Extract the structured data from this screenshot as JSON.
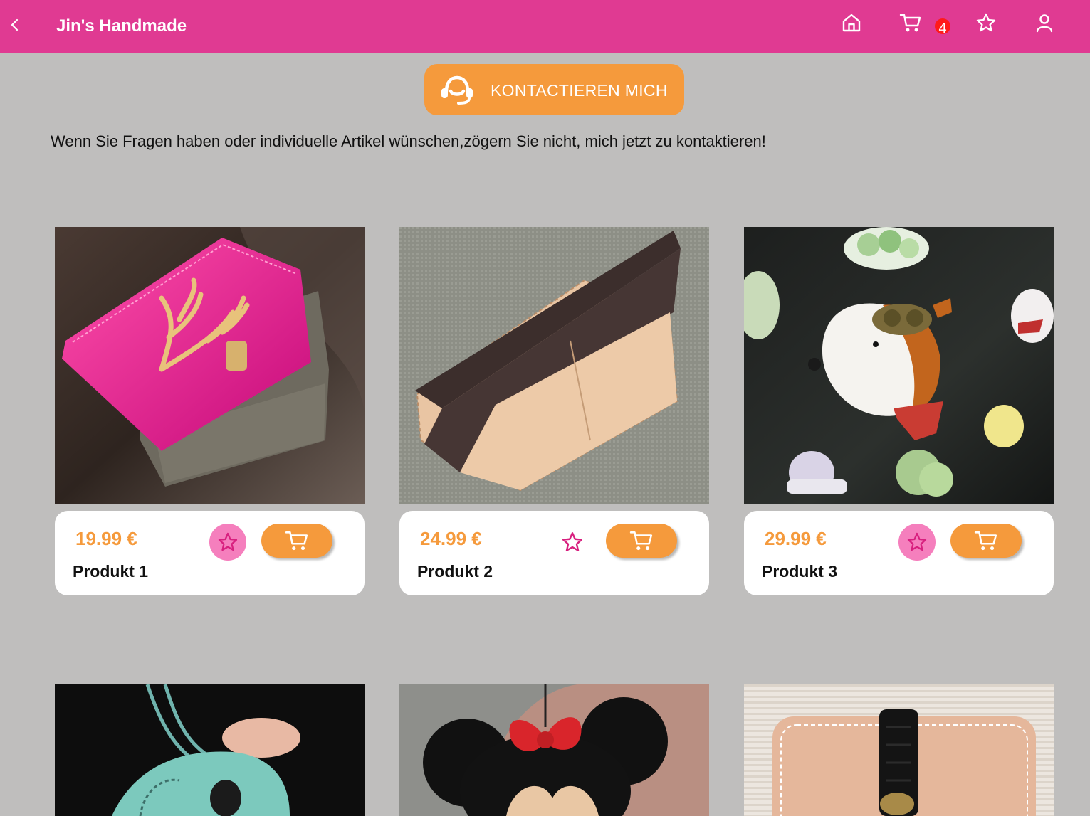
{
  "header": {
    "title": "Jin's Handmade",
    "back_icon": "chevron-left-icon",
    "nav_icons": [
      "home-icon",
      "cart-icon",
      "star-icon",
      "user-icon"
    ],
    "cart_count": "4",
    "background": "#e03a92"
  },
  "contact": {
    "button_label": "KONTACTIEREN MICH",
    "icon": "headset-icon",
    "intro": "Wenn Sie Fragen haben oder individuelle Artikel wünschen,zögern Sie nicht, mich jetzt zu kontaktieren!"
  },
  "colors": {
    "accent": "#f59a3c",
    "brand": "#e03a92",
    "favorite_active": "#f57fbd",
    "page_background": "#bfbebd"
  },
  "products": [
    {
      "name": "Produkt 1",
      "price": "19.99 €",
      "favorite": true,
      "image": "pink leather card wallet with gold deer clasp"
    },
    {
      "name": "Produkt 2",
      "price": "24.99 €",
      "favorite": false,
      "image": "dark brown and tan leather wallet"
    },
    {
      "name": "Produkt 3",
      "price": "29.99 €",
      "favorite": true,
      "image": "leather dog keychain on black leather"
    }
  ],
  "more_products_row": [
    {
      "image": "turquoise leather bag charm"
    },
    {
      "image": "black mouse-ear leather keychain with red bow"
    },
    {
      "image": "beige leather card holder with black strap"
    }
  ]
}
